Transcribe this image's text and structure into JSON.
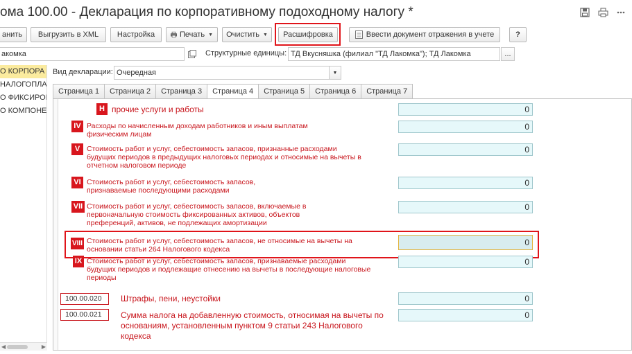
{
  "window": {
    "title": "ома 100.00 - Декларация по корпоративному подоходному налогу *"
  },
  "toolbar": {
    "save_label": "анить",
    "export_label": "Выгрузить в XML",
    "settings_label": "Настройка",
    "print_label": "Печать",
    "clear_label": "Очистить",
    "decode_label": "Расшифровка",
    "enter_doc_label": "Ввести документ отражения в учете",
    "help_label": "?"
  },
  "org": {
    "value": "акомка",
    "structural_units_label": "Структурные единицы:",
    "structural_units_value": "ТД Вкусняшка (филиал \"ТД Лакомка\"); ТД Лакомка",
    "more_btn": "..."
  },
  "left_tree": {
    "items": [
      "О КОРПОРА",
      "НАЛОГОПЛАТ",
      "О ФИКСИРОВ",
      "О КОМПОНЕ"
    ],
    "selected_index": 0
  },
  "declaration": {
    "type_label": "Вид декларации:",
    "type_value": "Очередная"
  },
  "tabs": [
    {
      "label": "Страница 1"
    },
    {
      "label": "Страница 2"
    },
    {
      "label": "Страница 3"
    },
    {
      "label": "Страница 4",
      "active": true
    },
    {
      "label": "Страница 5"
    },
    {
      "label": "Страница 6"
    },
    {
      "label": "Страница 7"
    }
  ],
  "rows": {
    "h": {
      "marker": "Н",
      "text": "прочие услуги и работы",
      "value": "0"
    },
    "iv": {
      "marker": "IV",
      "text": "Расходы по начисленным доходам работников и иным выплатам физическим лицам",
      "value": "0"
    },
    "v": {
      "marker": "V",
      "text": "Стоимость работ и услуг, себестоимость запасов, признанные расходами будущих периодов в предыдущих налоговых периодах и относимые на вычеты в отчетном налоговом периоде",
      "value": "0"
    },
    "vi": {
      "marker": "VI",
      "text": "Стоимость работ и услуг, себестоимость запасов, признаваемые последующими расходами",
      "value": "0"
    },
    "vii": {
      "marker": "VII",
      "text": "Стоимость работ и услуг, себестоимость запасов, включаемые в первоначальную стоимость фиксированных активов, объектов преференций, активов, не подлежащих амортизации",
      "value": "0"
    },
    "viii": {
      "marker": "VIII",
      "text": "Стоимость работ и услуг, себестоимость запасов, не относимые на вычеты на основании статьи 264 Налогового кодекса",
      "value": "0"
    },
    "ix": {
      "marker": "IX",
      "text": "Стоимость работ и услуг, себестоимость запасов, признаваемые расходами будущих периодов и подлежащие отнесению на вычеты в последующие налоговые периоды",
      "value": "0"
    },
    "c020": {
      "code": "100.00.020",
      "text": "Штрафы, пени, неустойки",
      "value": "0"
    },
    "c021": {
      "code": "100.00.021",
      "text": "Сумма налога на добавленную стоимость, относимая на вычеты по основаниям, установленным пунктом 9 статьи 243 Налогового кодекса",
      "value": "0"
    }
  },
  "colors": {
    "accent_red": "#d8161d",
    "value_bg": "#e6f8fa",
    "selection": "#fbeb9e"
  }
}
